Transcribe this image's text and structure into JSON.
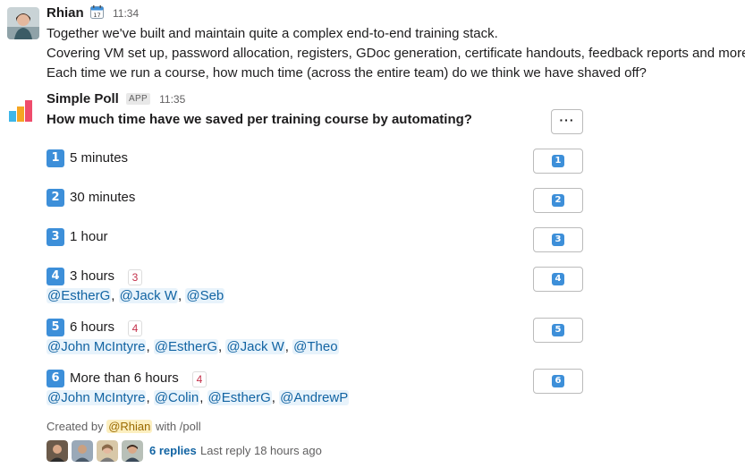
{
  "message1": {
    "author": "Rhian",
    "status_icon": "calendar-icon",
    "time": "11:34",
    "lines": [
      "Together we've built and maintain quite a complex end-to-end training stack.",
      "Covering VM set up, password allocation, registers, GDoc generation, certificate handouts, feedback reports and more.",
      "Each time we run a course, how much time (across the entire team) do we think we have shaved off?"
    ]
  },
  "message2": {
    "author": "Simple Poll",
    "app_badge": "APP",
    "time": "11:35",
    "question": "How much time have we saved per training course by automating?",
    "more_button": "···",
    "options": [
      {
        "number": "1",
        "label": "5 minutes",
        "count": "",
        "voters": []
      },
      {
        "number": "2",
        "label": "30 minutes",
        "count": "",
        "voters": []
      },
      {
        "number": "3",
        "label": "1 hour",
        "count": "",
        "voters": []
      },
      {
        "number": "4",
        "label": "3 hours",
        "count": "3",
        "voters": [
          "@EstherG",
          "@Jack W",
          "@Seb"
        ]
      },
      {
        "number": "5",
        "label": "6 hours",
        "count": "4",
        "voters": [
          "@John McIntyre",
          "@EstherG",
          "@Jack W",
          "@Theo"
        ]
      },
      {
        "number": "6",
        "label": "More than 6 hours",
        "count": "4",
        "voters": [
          "@John McIntyre",
          "@Colin",
          "@EstherG",
          "@AndrewP"
        ]
      }
    ],
    "footer": {
      "created_by": "Created by",
      "creator": "@Rhian",
      "with": "with /poll"
    },
    "thread": {
      "replies": "6 replies",
      "last_reply": "Last reply 18 hours ago"
    }
  },
  "colors": {
    "keycap": "#3d8fd9",
    "mention_text": "#1264a3",
    "mention_bg": "#e8f3fb",
    "count_text": "#c4314b",
    "creator_bg": "#fcefc0"
  }
}
